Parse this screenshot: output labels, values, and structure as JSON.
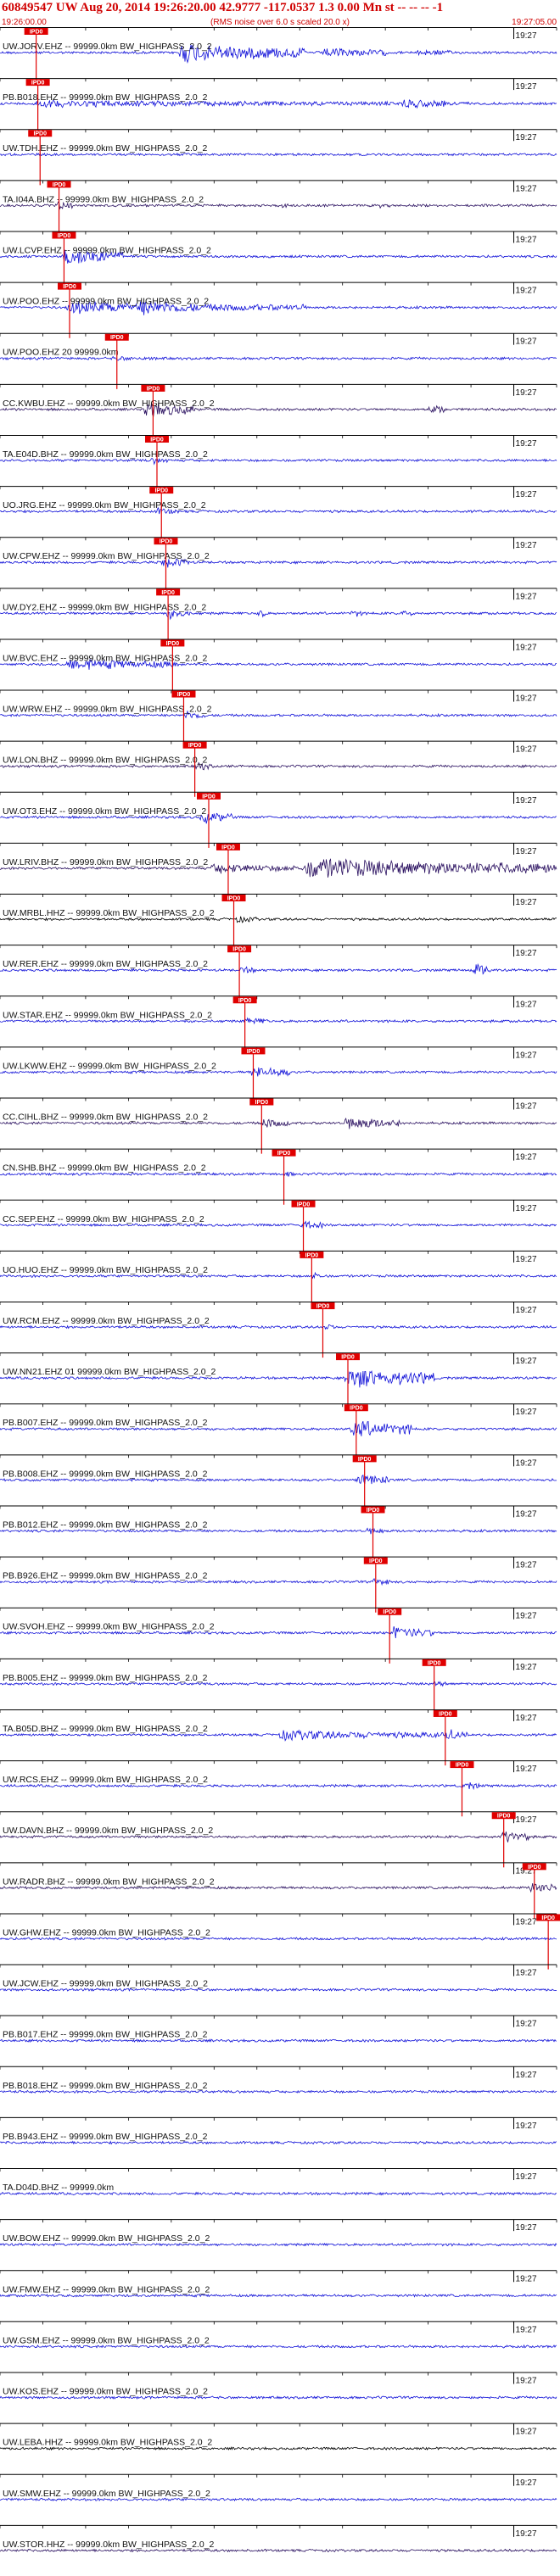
{
  "header": {
    "title": "60849547 UW Aug 20, 2014 19:26:20.00   42.9777 -117.0537  1.3 0.00 Mn st -- -- --   -1",
    "start_time": "19:26:00.00",
    "end_time": "19:27:05.00",
    "rms_note": "(RMS noise over 6.0 s scaled 20.0 x)"
  },
  "colors": {
    "trace_blue": "#1010d8",
    "trace_dark": "#2a1060",
    "trace_black": "#000000",
    "pick_red": "#e00000",
    "label_red": "#d00000"
  },
  "chart_data": {
    "type": "line",
    "title": "60849547 UW Aug 20, 2014 19:26:20.00   42.9777 -117.0537  1.3 0.00 Mn st -- -- --   -1",
    "x_range": [
      "19:26:00.00",
      "19:27:05.00"
    ],
    "time_tick_label": "19:27",
    "pick_label": "IPD0",
    "series": [
      {
        "name": "UW.JORV.EHZ -- 99999.0km BW_HIGHPASS_2.0_2",
        "color": "blue",
        "pick_frac": 0.065,
        "events": [
          [
            0.32,
            0.55,
            4.5
          ],
          [
            0.58,
            0.7,
            2.5
          ],
          [
            0.75,
            0.82,
            1.8
          ]
        ]
      },
      {
        "name": "PB.B018.EHZ -- 99999.0km BW_HIGHPASS_2.0_2",
        "color": "blue",
        "pick_frac": 0.068,
        "events": [
          [
            0.06,
            0.85,
            1.6
          ],
          [
            0.72,
            0.8,
            2.6
          ]
        ]
      },
      {
        "name": "UW.TDH.EHZ -- 99999.0km BW_HIGHPASS_2.0_2",
        "color": "blue",
        "pick_frac": 0.072,
        "events": []
      },
      {
        "name": "TA.I04A.BHZ -- 99999.0km BW_HIGHPASS_2.0_2",
        "color": "dark",
        "pick_frac": 0.106,
        "events": [
          [
            0.1,
            0.13,
            2.5
          ],
          [
            0.5,
            0.52,
            1.8
          ],
          [
            0.68,
            0.7,
            1.6
          ]
        ]
      },
      {
        "name": "UW.LCVP.EHZ -- 99999.0km BW_HIGHPASS_2.0_2",
        "color": "blue",
        "pick_frac": 0.115,
        "events": [
          [
            0.11,
            0.22,
            4.0
          ],
          [
            0.11,
            0.14,
            6.0
          ]
        ]
      },
      {
        "name": "UW.POO.EHZ -- 99999.0km BW_HIGHPASS_2.0_2",
        "color": "blue",
        "pick_frac": 0.125,
        "events": [
          [
            0.12,
            0.55,
            2.6
          ],
          [
            0.25,
            0.35,
            4.0
          ]
        ]
      },
      {
        "name": "UW.POO.EHZ 20 99999.0km",
        "color": "blue",
        "pick_frac": 0.21,
        "events": [
          [
            0.2,
            0.3,
            1.2
          ]
        ]
      },
      {
        "name": "CC.KWBU.EHZ -- 99999.0km BW_HIGHPASS_2.0_2",
        "color": "dark",
        "pick_frac": 0.275,
        "events": [
          [
            0.26,
            0.35,
            3.8
          ],
          [
            0.77,
            0.8,
            3.0
          ]
        ]
      },
      {
        "name": "TA.E04D.BHZ -- 99999.0km BW_HIGHPASS_2.0_2",
        "color": "blue",
        "pick_frac": 0.282,
        "events": [
          [
            0.27,
            0.3,
            2.0
          ]
        ]
      },
      {
        "name": "UO.JRG.EHZ -- 99999.0km BW_HIGHPASS_2.0_2",
        "color": "blue",
        "pick_frac": 0.29,
        "events": [
          [
            0.28,
            0.32,
            2.0
          ]
        ]
      },
      {
        "name": "UW.CPW.EHZ -- 99999.0km BW_HIGHPASS_2.0_2",
        "color": "blue",
        "pick_frac": 0.298,
        "events": [
          [
            0.29,
            0.34,
            3.0
          ]
        ]
      },
      {
        "name": "UW.DY2.EHZ -- 99999.0km BW_HIGHPASS_2.0_2",
        "color": "blue",
        "pick_frac": 0.302,
        "events": [
          [
            0.3,
            0.34,
            3.0
          ],
          [
            0.46,
            0.48,
            2.4
          ],
          [
            0.63,
            0.65,
            2.4
          ],
          [
            0.72,
            0.74,
            2.4
          ]
        ]
      },
      {
        "name": "UW.BVC.EHZ -- 99999.0km BW_HIGHPASS_2.0_2",
        "color": "blue",
        "pick_frac": 0.31,
        "events": [
          [
            0.12,
            0.32,
            2.8
          ]
        ]
      },
      {
        "name": "UW.WRW.EHZ -- 99999.0km BW_HIGHPASS_2.0_2",
        "color": "blue",
        "pick_frac": 0.33,
        "events": [
          [
            0.33,
            0.37,
            2.5
          ]
        ]
      },
      {
        "name": "UW.LON.BHZ -- 99999.0km BW_HIGHPASS_2.0_2",
        "color": "dark",
        "pick_frac": 0.35,
        "events": [
          [
            0.35,
            0.38,
            2.4
          ]
        ]
      },
      {
        "name": "UW.OT3.EHZ -- 99999.0km BW_HIGHPASS_2.0_2",
        "color": "blue",
        "pick_frac": 0.375,
        "events": [
          [
            0.36,
            0.42,
            3.0
          ]
        ]
      },
      {
        "name": "UW.LRIV.BHZ -- 99999.0km BW_HIGHPASS_2.0_2",
        "color": "dark",
        "pick_frac": 0.41,
        "events": [
          [
            0.55,
            1.0,
            4.5
          ],
          [
            0.38,
            0.55,
            2.4
          ]
        ]
      },
      {
        "name": "UW.MRBL.HHZ -- 99999.0km BW_HIGHPASS_2.0_2",
        "color": "black",
        "pick_frac": 0.42,
        "events": [
          [
            0.42,
            0.46,
            2.0
          ]
        ]
      },
      {
        "name": "UW.RER.EHZ -- 99999.0km BW_HIGHPASS_2.0_2",
        "color": "blue",
        "pick_frac": 0.43,
        "events": [
          [
            0.43,
            0.46,
            2.0
          ],
          [
            0.85,
            0.88,
            4.0
          ]
        ]
      },
      {
        "name": "UW.STAR.EHZ -- 99999.0km BW_HIGHPASS_2.0_2",
        "color": "blue",
        "pick_frac": 0.44,
        "events": [
          [
            0.44,
            0.48,
            2.2
          ]
        ]
      },
      {
        "name": "UW.LKWW.EHZ -- 99999.0km BW_HIGHPASS_2.0_2",
        "color": "blue",
        "pick_frac": 0.455,
        "events": [
          [
            0.45,
            0.52,
            3.0
          ]
        ]
      },
      {
        "name": "CC.CIHL.BHZ -- 99999.0km BW_HIGHPASS_2.0_2",
        "color": "dark",
        "pick_frac": 0.47,
        "events": [
          [
            0.47,
            0.52,
            2.6
          ],
          [
            0.62,
            0.72,
            3.2
          ]
        ]
      },
      {
        "name": "CN.SHB.BHZ -- 99999.0km BW_HIGHPASS_2.0_2",
        "color": "blue",
        "pick_frac": 0.51,
        "events": [
          [
            0.51,
            0.53,
            1.8
          ]
        ]
      },
      {
        "name": "CC.SEP.EHZ -- 99999.0km BW_HIGHPASS_2.0_2",
        "color": "blue",
        "pick_frac": 0.545,
        "events": [
          [
            0.54,
            0.58,
            2.4
          ]
        ]
      },
      {
        "name": "UO.HUO.EHZ -- 99999.0km BW_HIGHPASS_2.0_2",
        "color": "blue",
        "pick_frac": 0.56,
        "events": [
          [
            0.56,
            0.58,
            2.6
          ]
        ]
      },
      {
        "name": "UW.RCM.EHZ -- 99999.0km BW_HIGHPASS_2.0_2",
        "color": "blue",
        "pick_frac": 0.58,
        "events": [
          [
            0.58,
            0.6,
            2.2
          ]
        ]
      },
      {
        "name": "UW.NN21.EHZ 01 99999.0km BW_HIGHPASS_2.0_2",
        "color": "blue",
        "pick_frac": 0.625,
        "events": [
          [
            0.62,
            0.78,
            4.8
          ]
        ]
      },
      {
        "name": "PB.B007.EHZ -- 99999.0km BW_HIGHPASS_2.0_2",
        "color": "blue",
        "pick_frac": 0.64,
        "events": [
          [
            0.63,
            0.74,
            4.2
          ]
        ]
      },
      {
        "name": "PB.B008.EHZ -- 99999.0km BW_HIGHPASS_2.0_2",
        "color": "blue",
        "pick_frac": 0.655,
        "events": [
          [
            0.64,
            0.7,
            3.0
          ]
        ]
      },
      {
        "name": "PB.B012.EHZ -- 99999.0km BW_HIGHPASS_2.0_2",
        "color": "blue",
        "pick_frac": 0.67,
        "events": [
          [
            0.66,
            0.69,
            2.2
          ]
        ]
      },
      {
        "name": "PB.B926.EHZ -- 99999.0km BW_HIGHPASS_2.0_2",
        "color": "blue",
        "pick_frac": 0.675,
        "events": [
          [
            0.67,
            0.7,
            2.4
          ]
        ]
      },
      {
        "name": "UW.SVOH.EHZ -- 99999.0km BW_HIGHPASS_2.0_2",
        "color": "blue",
        "pick_frac": 0.7,
        "events": [
          [
            0.7,
            0.78,
            3.0
          ]
        ]
      },
      {
        "name": "PB.B005.EHZ -- 99999.0km BW_HIGHPASS_2.0_2",
        "color": "blue",
        "pick_frac": 0.78,
        "events": [
          [
            0.78,
            0.8,
            2.0
          ]
        ]
      },
      {
        "name": "TA.B05D.BHZ -- 99999.0km BW_HIGHPASS_2.0_2",
        "color": "blue",
        "pick_frac": 0.8,
        "events": [
          [
            0.5,
            0.84,
            2.2
          ],
          [
            0.8,
            0.83,
            3.4
          ]
        ]
      },
      {
        "name": "UW.RCS.EHZ -- 99999.0km BW_HIGHPASS_2.0_2",
        "color": "blue",
        "pick_frac": 0.83,
        "events": [
          [
            0.83,
            0.86,
            2.4
          ]
        ]
      },
      {
        "name": "UW.DAVN.BHZ -- 99999.0km BW_HIGHPASS_2.0_2",
        "color": "dark",
        "pick_frac": 0.905,
        "events": [
          [
            0.9,
            0.95,
            3.2
          ]
        ]
      },
      {
        "name": "UW.RADR.BHZ -- 99999.0km BW_HIGHPASS_2.0_2",
        "color": "dark",
        "pick_frac": 0.96,
        "events": [
          [
            0.95,
            1.0,
            3.2
          ]
        ]
      },
      {
        "name": "UW.GHW.EHZ -- 99999.0km BW_HIGHPASS_2.0_2",
        "color": "blue",
        "pick_frac": 0.985,
        "events": []
      },
      {
        "name": "UW.JCW.EHZ -- 99999.0km BW_HIGHPASS_2.0_2",
        "color": "blue",
        "pick_frac": null,
        "events": []
      },
      {
        "name": "PB.B017.EHZ -- 99999.0km BW_HIGHPASS_2.0_2",
        "color": "blue",
        "pick_frac": null,
        "events": []
      },
      {
        "name": "PB.B018.EHZ -- 99999.0km BW_HIGHPASS_2.0_2",
        "color": "blue",
        "pick_frac": null,
        "events": []
      },
      {
        "name": "PB.B943.EHZ -- 99999.0km BW_HIGHPASS_2.0_2",
        "color": "blue",
        "pick_frac": null,
        "events": []
      },
      {
        "name": "TA.D04D.BHZ -- 99999.0km",
        "color": "blue",
        "pick_frac": null,
        "events": []
      },
      {
        "name": "UW.BOW.EHZ -- 99999.0km BW_HIGHPASS_2.0_2",
        "color": "blue",
        "pick_frac": null,
        "events": []
      },
      {
        "name": "UW.FMW.EHZ -- 99999.0km BW_HIGHPASS_2.0_2",
        "color": "blue",
        "pick_frac": null,
        "events": []
      },
      {
        "name": "UW.GSM.EHZ -- 99999.0km BW_HIGHPASS_2.0_2",
        "color": "blue",
        "pick_frac": null,
        "events": []
      },
      {
        "name": "UW.KOS.EHZ -- 99999.0km BW_HIGHPASS_2.0_2",
        "color": "blue",
        "pick_frac": null,
        "events": []
      },
      {
        "name": "UW.LEBA.HHZ -- 99999.0km BW_HIGHPASS_2.0_2",
        "color": "black",
        "pick_frac": null,
        "events": []
      },
      {
        "name": "UW.SMW.EHZ -- 99999.0km BW_HIGHPASS_2.0_2",
        "color": "blue",
        "pick_frac": null,
        "events": []
      },
      {
        "name": "UW.STOR.HHZ -- 99999.0km BW_HIGHPASS_2.0_2",
        "color": "dark",
        "pick_frac": null,
        "events": []
      }
    ]
  }
}
